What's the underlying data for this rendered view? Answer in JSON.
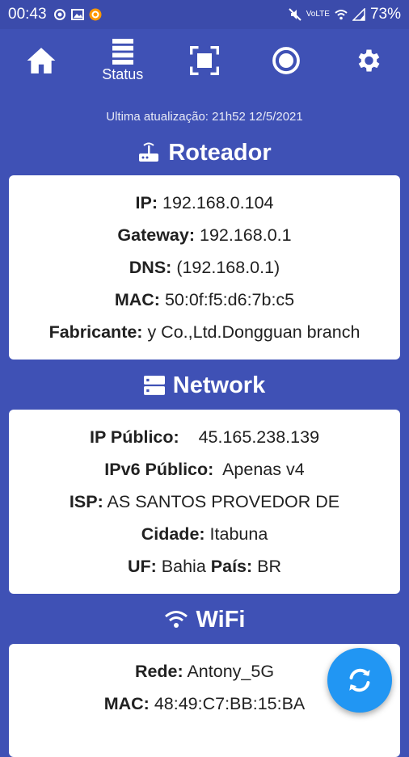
{
  "statusbar": {
    "time": "00:43",
    "battery": "73%",
    "signal_text": "VoLTE"
  },
  "nav": {
    "items": [
      {
        "icon": "home-icon",
        "label": ""
      },
      {
        "icon": "status-icon",
        "label": "Status"
      },
      {
        "icon": "scan-icon",
        "label": ""
      },
      {
        "icon": "radar-icon",
        "label": ""
      },
      {
        "icon": "gear-icon",
        "label": ""
      }
    ]
  },
  "last_update": "Ultima atualização: 21h52 12/5/2021",
  "router": {
    "title": "Roteador",
    "rows": [
      {
        "label": "IP:",
        "value": "192.168.0.104"
      },
      {
        "label": "Gateway:",
        "value": "192.168.0.1"
      },
      {
        "label": "DNS:",
        "value": "(192.168.0.1)"
      },
      {
        "label": "MAC:",
        "value": "50:0f:f5:d6:7b:c5"
      },
      {
        "label": "Fabricante:",
        "value": "y Co.,Ltd.Dongguan branch"
      }
    ]
  },
  "network": {
    "title": "Network",
    "rows": [
      {
        "label": "IP Público:",
        "value": "45.165.238.139"
      },
      {
        "label": "IPv6 Público:",
        "value": "Apenas v4"
      },
      {
        "label": "ISP:",
        "value": "AS SANTOS PROVEDOR DE"
      },
      {
        "label": "Cidade:",
        "value": "Itabuna"
      },
      {
        "label": "UF:",
        "value": "Bahia",
        "label2": "País:",
        "value2": "BR"
      }
    ]
  },
  "wifi": {
    "title": "WiFi",
    "rows": [
      {
        "label": "Rede:",
        "value": "Antony_5G"
      },
      {
        "label": "MAC:",
        "value": "48:49:C7:BB:15:BA"
      }
    ]
  },
  "colors": {
    "primary": "#3f51b5",
    "fab": "#2196f3"
  }
}
